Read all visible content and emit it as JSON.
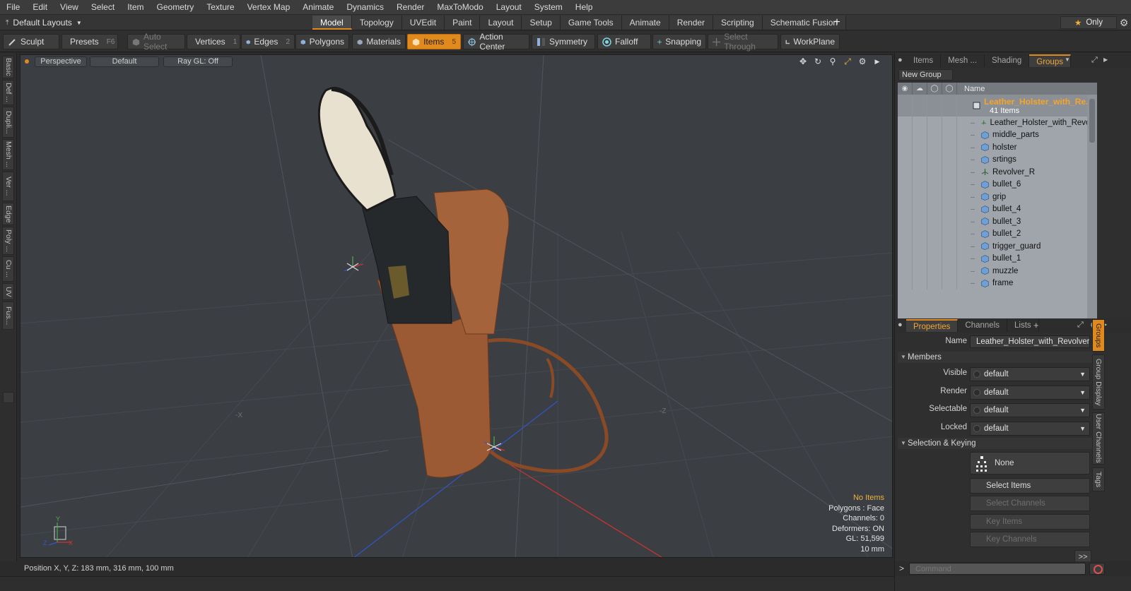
{
  "menu": [
    "File",
    "Edit",
    "View",
    "Select",
    "Item",
    "Geometry",
    "Texture",
    "Vertex Map",
    "Animate",
    "Dynamics",
    "Render",
    "MaxToModo",
    "Layout",
    "System",
    "Help"
  ],
  "layouts": {
    "label": "Default Layouts"
  },
  "mode_tabs": [
    "Model",
    "Topology",
    "UVEdit",
    "Paint",
    "Layout",
    "Setup",
    "Game Tools",
    "Animate",
    "Render",
    "Scripting",
    "Schematic Fusion"
  ],
  "active_mode_tab": "Model",
  "only_label": "Only",
  "toolbar": {
    "sculpt": "Sculpt",
    "presets": "Presets",
    "presets_key": "F6",
    "auto_select": "Auto Select",
    "vertices": "Vertices",
    "vertices_key": "1",
    "edges": "Edges",
    "edges_key": "2",
    "polygons": "Polygons",
    "materials": "Materials",
    "items": "Items",
    "items_key": "5",
    "action_center": "Action Center",
    "symmetry": "Symmetry",
    "falloff": "Falloff",
    "snapping": "Snapping",
    "select_through": "Select Through",
    "workplane": "WorkPlane"
  },
  "left_tabs": [
    "Basic",
    "Def ...",
    "Dupli...",
    "Mesh ...",
    "Ver ...",
    "Edge",
    "Poly ...",
    "Cu ...",
    "UV",
    "Fus..."
  ],
  "viewport": {
    "view": "Perspective",
    "shading": "Default",
    "raygl": "Ray GL: Off",
    "axis_x_neg": "-X",
    "axis_z_neg": "-Z",
    "info": {
      "selection": "No Items",
      "polygons": "Polygons : Face",
      "channels": "Channels: 0",
      "deformers": "Deformers: ON",
      "gl": "GL: 51,599",
      "scale": "10 mm"
    }
  },
  "status": {
    "position": "Position X, Y, Z:  183 mm, 316 mm, 100 mm"
  },
  "top_panel": {
    "tabs": [
      "Items",
      "Mesh ...",
      "Shading",
      "Groups"
    ],
    "active_tab": "Groups",
    "new_group": "New Group",
    "column_name": "Name",
    "root": {
      "name": "Leather_Holster_with_Re...",
      "count": "41 Items"
    },
    "items": [
      {
        "name": "Leather_Holster_with_Revo...",
        "type": "locator"
      },
      {
        "name": "middle_parts",
        "type": "mesh"
      },
      {
        "name": "holster",
        "type": "mesh"
      },
      {
        "name": "srtings",
        "type": "mesh"
      },
      {
        "name": "Revolver_R",
        "type": "locator"
      },
      {
        "name": "bullet_6",
        "type": "mesh"
      },
      {
        "name": "grip",
        "type": "mesh"
      },
      {
        "name": "bullet_4",
        "type": "mesh"
      },
      {
        "name": "bullet_3",
        "type": "mesh"
      },
      {
        "name": "bullet_2",
        "type": "mesh"
      },
      {
        "name": "trigger_guard",
        "type": "mesh"
      },
      {
        "name": "bullet_1",
        "type": "mesh"
      },
      {
        "name": "muzzle",
        "type": "mesh"
      },
      {
        "name": "frame",
        "type": "mesh"
      }
    ]
  },
  "properties": {
    "tabs": [
      "Properties",
      "Channels",
      "Lists"
    ],
    "active_tab": "Properties",
    "name_label": "Name",
    "name_value": "Leather_Holster_with_Revolver (",
    "members_section": "Members",
    "visible_label": "Visible",
    "visible_value": "default",
    "render_label": "Render",
    "render_value": "default",
    "selectable_label": "Selectable",
    "selectable_value": "default",
    "locked_label": "Locked",
    "locked_value": "default",
    "selkey_section": "Selection & Keying",
    "none_label": "None",
    "select_items": "Select Items",
    "select_channels": "Select Channels",
    "key_items": "Key Items",
    "key_channels": "Key Channels",
    "more": ">>"
  },
  "side_tabs": [
    "Groups",
    "Group Display",
    "User Channels",
    "Tags"
  ],
  "command": {
    "placeholder": "Command",
    "caret": ">"
  },
  "colors": {
    "accent": "#e08a1e",
    "warning": "#f0b040",
    "viewport_bg": "#3b3f44",
    "leather": "#9c5a34"
  }
}
